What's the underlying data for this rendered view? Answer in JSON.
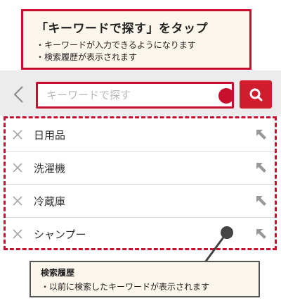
{
  "callout_top": {
    "title": "「キーワードで探す」をタップ",
    "bullets": [
      "・キーワードが入力できるようになります",
      "・検索履歴が表示されます"
    ]
  },
  "search": {
    "placeholder": "キーワードで探す",
    "back_icon": "chevron-left-icon",
    "search_icon": "search-icon"
  },
  "history": {
    "items": [
      {
        "label": "日用品"
      },
      {
        "label": "洗濯機"
      },
      {
        "label": "冷蔵庫"
      },
      {
        "label": "シャンプー"
      }
    ]
  },
  "callout_bottom": {
    "title": "検索履歴",
    "bullet": "・以前に検索したキーワードが表示されます"
  },
  "colors": {
    "accent": "#c8102e",
    "search_area_bg": "#ececec",
    "callout_bg": "#fdf6ec"
  }
}
